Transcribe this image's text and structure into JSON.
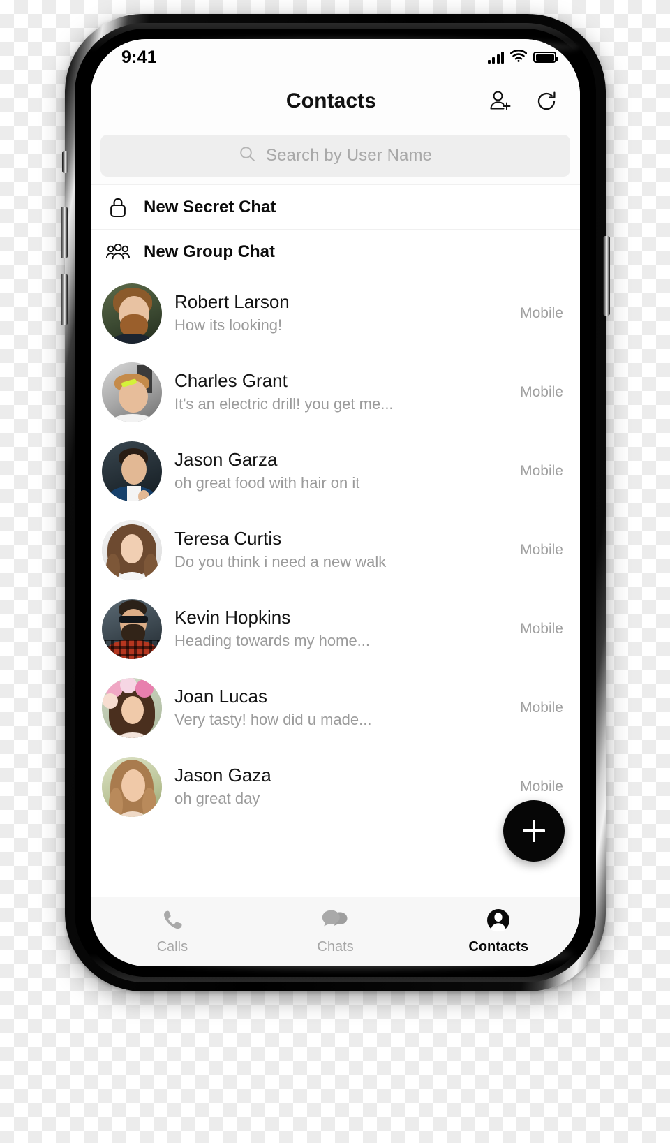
{
  "status_bar": {
    "time": "9:41",
    "signal_icon": "cellular-signal-icon",
    "wifi_icon": "wifi-icon",
    "battery_icon": "battery-full-icon"
  },
  "header": {
    "title": "Contacts",
    "actions": [
      {
        "name": "add-contact-button",
        "icon": "person-add-icon"
      },
      {
        "name": "refresh-button",
        "icon": "refresh-icon"
      }
    ]
  },
  "search": {
    "placeholder": "Search by User Name",
    "value": "",
    "icon": "search-icon"
  },
  "quick_actions": [
    {
      "label": "New Secret Chat",
      "icon": "lock-icon"
    },
    {
      "label": "New Group Chat",
      "icon": "group-people-icon"
    }
  ],
  "contacts": [
    {
      "name": "Robert Larson",
      "message": "How its looking!",
      "meta": "Mobile",
      "avatar": "bearded-man-ginger"
    },
    {
      "name": "Charles Grant",
      "message": "It's an electric drill! you get me...",
      "meta": "Mobile",
      "avatar": "man-workshop"
    },
    {
      "name": "Jason Garza",
      "message": "oh great food with hair on it",
      "meta": "Mobile",
      "avatar": "man-blue-suit"
    },
    {
      "name": "Teresa Curtis",
      "message": "Do you think i need a new walk",
      "meta": "Mobile",
      "avatar": "woman-curly-hair"
    },
    {
      "name": "Kevin Hopkins",
      "message": "Heading towards my home...",
      "meta": "Mobile",
      "avatar": "man-sunglasses-plaid"
    },
    {
      "name": "Joan Lucas",
      "message": "Very tasty! how did u made...",
      "meta": "Mobile",
      "avatar": "woman-flower-crown"
    },
    {
      "name": "Jason Gaza",
      "message": "oh great day",
      "meta": "Mobile",
      "avatar": "woman-blonde-outdoor"
    }
  ],
  "fab": {
    "label": "+",
    "icon": "plus-icon"
  },
  "tabs": [
    {
      "label": "Calls",
      "icon": "phone-icon",
      "active": false
    },
    {
      "label": "Chats",
      "icon": "chat-bubbles-icon",
      "active": false
    },
    {
      "label": "Contacts",
      "icon": "person-filled-icon",
      "active": true
    }
  ],
  "colors": {
    "accent": "#000000",
    "screen_bg": "#ffffff",
    "search_bg": "#eeeeee",
    "tabbar_bg": "#f7f7f7",
    "muted_text": "#9b9b9b",
    "active_tab": "#0a0a0a"
  }
}
